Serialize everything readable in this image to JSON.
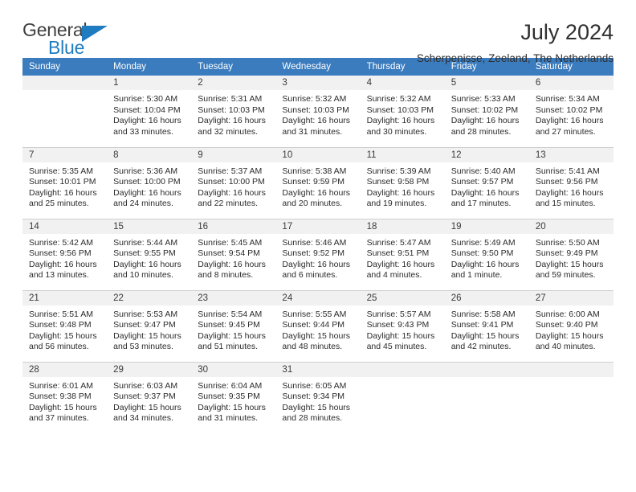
{
  "brand": {
    "word1": "General",
    "word2": "Blue",
    "triangle_icon": "brand-triangle-icon",
    "accent_color": "#1f7cc0"
  },
  "header": {
    "title": "July 2024",
    "subtitle": "Scherpenisse, Zeeland, The Netherlands",
    "header_bg_color": "#3b7cbe",
    "daynum_bg_color": "#f1f1f1"
  },
  "calendar": {
    "weekday_headers": [
      "Sunday",
      "Monday",
      "Tuesday",
      "Wednesday",
      "Thursday",
      "Friday",
      "Saturday"
    ],
    "weeks": [
      [
        {
          "day": "",
          "lines": []
        },
        {
          "day": "1",
          "lines": [
            "Sunrise: 5:30 AM",
            "Sunset: 10:04 PM",
            "Daylight: 16 hours",
            "and 33 minutes."
          ]
        },
        {
          "day": "2",
          "lines": [
            "Sunrise: 5:31 AM",
            "Sunset: 10:03 PM",
            "Daylight: 16 hours",
            "and 32 minutes."
          ]
        },
        {
          "day": "3",
          "lines": [
            "Sunrise: 5:32 AM",
            "Sunset: 10:03 PM",
            "Daylight: 16 hours",
            "and 31 minutes."
          ]
        },
        {
          "day": "4",
          "lines": [
            "Sunrise: 5:32 AM",
            "Sunset: 10:03 PM",
            "Daylight: 16 hours",
            "and 30 minutes."
          ]
        },
        {
          "day": "5",
          "lines": [
            "Sunrise: 5:33 AM",
            "Sunset: 10:02 PM",
            "Daylight: 16 hours",
            "and 28 minutes."
          ]
        },
        {
          "day": "6",
          "lines": [
            "Sunrise: 5:34 AM",
            "Sunset: 10:02 PM",
            "Daylight: 16 hours",
            "and 27 minutes."
          ]
        }
      ],
      [
        {
          "day": "7",
          "lines": [
            "Sunrise: 5:35 AM",
            "Sunset: 10:01 PM",
            "Daylight: 16 hours",
            "and 25 minutes."
          ]
        },
        {
          "day": "8",
          "lines": [
            "Sunrise: 5:36 AM",
            "Sunset: 10:00 PM",
            "Daylight: 16 hours",
            "and 24 minutes."
          ]
        },
        {
          "day": "9",
          "lines": [
            "Sunrise: 5:37 AM",
            "Sunset: 10:00 PM",
            "Daylight: 16 hours",
            "and 22 minutes."
          ]
        },
        {
          "day": "10",
          "lines": [
            "Sunrise: 5:38 AM",
            "Sunset: 9:59 PM",
            "Daylight: 16 hours",
            "and 20 minutes."
          ]
        },
        {
          "day": "11",
          "lines": [
            "Sunrise: 5:39 AM",
            "Sunset: 9:58 PM",
            "Daylight: 16 hours",
            "and 19 minutes."
          ]
        },
        {
          "day": "12",
          "lines": [
            "Sunrise: 5:40 AM",
            "Sunset: 9:57 PM",
            "Daylight: 16 hours",
            "and 17 minutes."
          ]
        },
        {
          "day": "13",
          "lines": [
            "Sunrise: 5:41 AM",
            "Sunset: 9:56 PM",
            "Daylight: 16 hours",
            "and 15 minutes."
          ]
        }
      ],
      [
        {
          "day": "14",
          "lines": [
            "Sunrise: 5:42 AM",
            "Sunset: 9:56 PM",
            "Daylight: 16 hours",
            "and 13 minutes."
          ]
        },
        {
          "day": "15",
          "lines": [
            "Sunrise: 5:44 AM",
            "Sunset: 9:55 PM",
            "Daylight: 16 hours",
            "and 10 minutes."
          ]
        },
        {
          "day": "16",
          "lines": [
            "Sunrise: 5:45 AM",
            "Sunset: 9:54 PM",
            "Daylight: 16 hours",
            "and 8 minutes."
          ]
        },
        {
          "day": "17",
          "lines": [
            "Sunrise: 5:46 AM",
            "Sunset: 9:52 PM",
            "Daylight: 16 hours",
            "and 6 minutes."
          ]
        },
        {
          "day": "18",
          "lines": [
            "Sunrise: 5:47 AM",
            "Sunset: 9:51 PM",
            "Daylight: 16 hours",
            "and 4 minutes."
          ]
        },
        {
          "day": "19",
          "lines": [
            "Sunrise: 5:49 AM",
            "Sunset: 9:50 PM",
            "Daylight: 16 hours",
            "and 1 minute."
          ]
        },
        {
          "day": "20",
          "lines": [
            "Sunrise: 5:50 AM",
            "Sunset: 9:49 PM",
            "Daylight: 15 hours",
            "and 59 minutes."
          ]
        }
      ],
      [
        {
          "day": "21",
          "lines": [
            "Sunrise: 5:51 AM",
            "Sunset: 9:48 PM",
            "Daylight: 15 hours",
            "and 56 minutes."
          ]
        },
        {
          "day": "22",
          "lines": [
            "Sunrise: 5:53 AM",
            "Sunset: 9:47 PM",
            "Daylight: 15 hours",
            "and 53 minutes."
          ]
        },
        {
          "day": "23",
          "lines": [
            "Sunrise: 5:54 AM",
            "Sunset: 9:45 PM",
            "Daylight: 15 hours",
            "and 51 minutes."
          ]
        },
        {
          "day": "24",
          "lines": [
            "Sunrise: 5:55 AM",
            "Sunset: 9:44 PM",
            "Daylight: 15 hours",
            "and 48 minutes."
          ]
        },
        {
          "day": "25",
          "lines": [
            "Sunrise: 5:57 AM",
            "Sunset: 9:43 PM",
            "Daylight: 15 hours",
            "and 45 minutes."
          ]
        },
        {
          "day": "26",
          "lines": [
            "Sunrise: 5:58 AM",
            "Sunset: 9:41 PM",
            "Daylight: 15 hours",
            "and 42 minutes."
          ]
        },
        {
          "day": "27",
          "lines": [
            "Sunrise: 6:00 AM",
            "Sunset: 9:40 PM",
            "Daylight: 15 hours",
            "and 40 minutes."
          ]
        }
      ],
      [
        {
          "day": "28",
          "lines": [
            "Sunrise: 6:01 AM",
            "Sunset: 9:38 PM",
            "Daylight: 15 hours",
            "and 37 minutes."
          ]
        },
        {
          "day": "29",
          "lines": [
            "Sunrise: 6:03 AM",
            "Sunset: 9:37 PM",
            "Daylight: 15 hours",
            "and 34 minutes."
          ]
        },
        {
          "day": "30",
          "lines": [
            "Sunrise: 6:04 AM",
            "Sunset: 9:35 PM",
            "Daylight: 15 hours",
            "and 31 minutes."
          ]
        },
        {
          "day": "31",
          "lines": [
            "Sunrise: 6:05 AM",
            "Sunset: 9:34 PM",
            "Daylight: 15 hours",
            "and 28 minutes."
          ]
        },
        {
          "day": "",
          "lines": []
        },
        {
          "day": "",
          "lines": []
        },
        {
          "day": "",
          "lines": []
        }
      ]
    ]
  }
}
